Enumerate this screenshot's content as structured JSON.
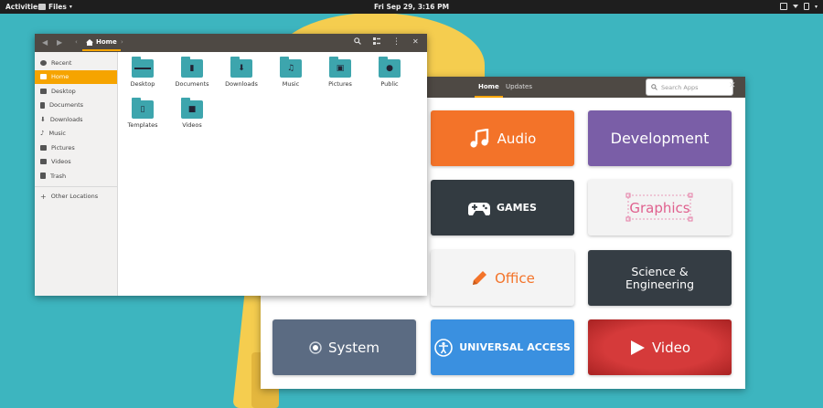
{
  "topbar": {
    "activities": "Activities",
    "app": "Files",
    "clock": "Fri Sep 29,  3:16 PM"
  },
  "software": {
    "tabs": [
      {
        "label": "Home"
      },
      {
        "label": "Updates"
      }
    ],
    "search_placeholder": "Search Apps",
    "categories": [
      {
        "label": "Audio",
        "color": "#f37329"
      },
      {
        "label": "Development",
        "color": "#7a5ea7"
      },
      {
        "label": "GAMES",
        "color": "#333b41"
      },
      {
        "label": "Graphics",
        "color": "#f3f3f3"
      },
      {
        "label": "Office",
        "color": "#f4f4f4"
      },
      {
        "label": "Science & Engineering",
        "color": "#353d44"
      },
      {
        "label": "System",
        "color": "#5b6b82"
      },
      {
        "label": "UNIVERSAL ACCESS",
        "color": "#3a90e0"
      },
      {
        "label": "Video",
        "color": "#d23a3a"
      }
    ]
  },
  "files": {
    "location": "Home",
    "sidebar": [
      {
        "label": "Recent",
        "icon": "clock-icon"
      },
      {
        "label": "Home",
        "icon": "home-icon"
      },
      {
        "label": "Desktop",
        "icon": "desktop-icon"
      },
      {
        "label": "Documents",
        "icon": "document-icon"
      },
      {
        "label": "Downloads",
        "icon": "download-icon"
      },
      {
        "label": "Music",
        "icon": "music-icon"
      },
      {
        "label": "Pictures",
        "icon": "picture-icon"
      },
      {
        "label": "Videos",
        "icon": "video-icon"
      },
      {
        "label": "Trash",
        "icon": "trash-icon"
      },
      {
        "label": "Other Locations",
        "icon": "plus-icon"
      }
    ],
    "items": [
      {
        "label": "Desktop"
      },
      {
        "label": "Documents"
      },
      {
        "label": "Downloads"
      },
      {
        "label": "Music"
      },
      {
        "label": "Pictures"
      },
      {
        "label": "Public"
      },
      {
        "label": "Templates"
      },
      {
        "label": "Videos"
      }
    ]
  }
}
